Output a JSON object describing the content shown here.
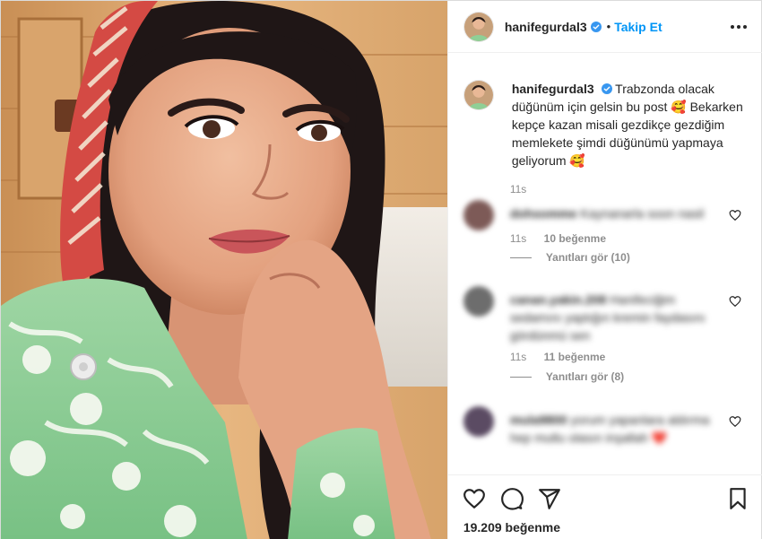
{
  "post": {
    "username": "hanifegurdal3",
    "follow_label": "Takip Et",
    "separator": "•",
    "verified": true,
    "caption": "Trabzonda olacak düğünüm için gelsin bu post 🥰 Bekarken kepçe kazan misali gezdikçe gezdiğim memlekete şimdi düğünümü yapmaya geliyorum 🥰",
    "caption_time": "11s",
    "like_count": "19.209 beğenme"
  },
  "comments": [
    {
      "username": "dohsomme",
      "text": "Kaynanarla soon nasil",
      "time": "11s",
      "likes": "10 beğenme",
      "replies": "Yanıtları gör (10)",
      "blurred": true
    },
    {
      "username": "canan.yakin.208",
      "text": "Hanifeciğim sedamını yaptığın kremin faydasını gördünmü sen",
      "time": "11s",
      "likes": "11 beğenme",
      "replies": "Yanıtları gör (8)",
      "blurred": true
    },
    {
      "username": "mula9800",
      "text": "yorum yapanlara aldırma hep mutlu olasın inşallah ❤️",
      "blurred": true
    }
  ],
  "colors": {
    "accent": "#0095f6",
    "text": "#262626",
    "muted": "#8e8e8e",
    "border": "#efefef"
  },
  "icons": [
    "verified-badge-icon",
    "more-options-icon",
    "heart-icon",
    "comment-icon",
    "share-icon",
    "bookmark-icon",
    "smiling-face-with-hearts-emoji"
  ]
}
